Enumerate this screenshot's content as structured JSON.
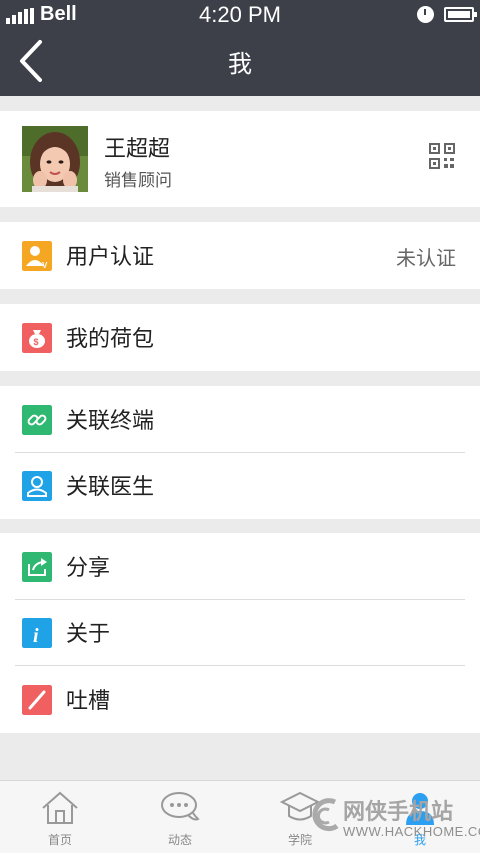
{
  "status_bar": {
    "carrier": "Bell",
    "time": "4:20 PM"
  },
  "nav": {
    "title": "我"
  },
  "profile": {
    "name": "王超超",
    "role": "销售顾问"
  },
  "menu": {
    "verify": {
      "label": "用户认证",
      "value": "未认证",
      "icon": "user-verify-icon",
      "color": "#f5a623"
    },
    "wallet": {
      "label": "我的荷包",
      "icon": "money-bag-icon",
      "color": "#f06060"
    },
    "terminal": {
      "label": "关联终端",
      "icon": "link-icon",
      "color": "#2fb871"
    },
    "doctor": {
      "label": "关联医生",
      "icon": "doctor-icon",
      "color": "#20a3e6"
    },
    "share": {
      "label": "分享",
      "icon": "share-icon",
      "color": "#2fb871"
    },
    "about": {
      "label": "关于",
      "icon": "info-icon",
      "color": "#20a3e6"
    },
    "feedback": {
      "label": "吐槽",
      "icon": "pencil-icon",
      "color": "#f06060"
    }
  },
  "tabs": [
    {
      "label": "首页",
      "icon": "home-icon"
    },
    {
      "label": "动态",
      "icon": "chat-icon"
    },
    {
      "label": "学院",
      "icon": "academy-icon"
    },
    {
      "label": "我",
      "icon": "person-icon"
    }
  ],
  "watermark": {
    "title": "网侠手机站",
    "url": "WWW.HACKHOME.COM"
  },
  "colors": {
    "header": "#3d4049",
    "background": "#ebebeb",
    "active_tab": "#2c9ff0"
  }
}
